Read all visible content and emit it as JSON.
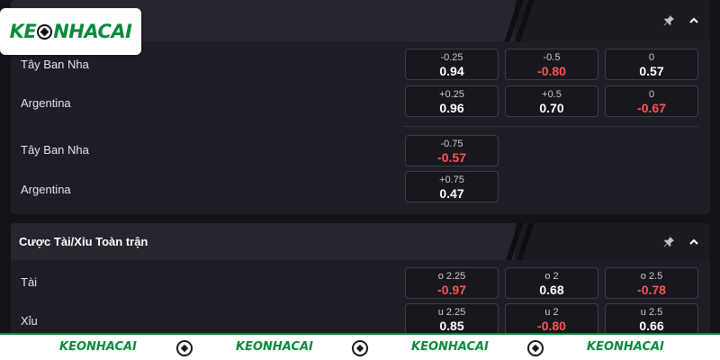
{
  "logo": {
    "part1": "KE",
    "part2": "NHACAI"
  },
  "panel1": {
    "handicap": {
      "rows": [
        {
          "team": "Tây Ban Nha",
          "odds": [
            {
              "line": "-0.25",
              "price": "0.94",
              "neg": false
            },
            {
              "line": "-0.5",
              "price": "-0.80",
              "neg": true
            },
            {
              "line": "0",
              "price": "0.57",
              "neg": false
            }
          ]
        },
        {
          "team": "Argentina",
          "odds": [
            {
              "line": "+0.25",
              "price": "0.96",
              "neg": false
            },
            {
              "line": "+0.5",
              "price": "0.70",
              "neg": false
            },
            {
              "line": "0",
              "price": "-0.67",
              "neg": true
            }
          ]
        }
      ]
    },
    "extra": {
      "rows": [
        {
          "team": "Tây Ban Nha",
          "odds": [
            {
              "line": "-0.75",
              "price": "-0.57",
              "neg": true
            }
          ]
        },
        {
          "team": "Argentina",
          "odds": [
            {
              "line": "+0.75",
              "price": "0.47",
              "neg": false
            }
          ]
        }
      ]
    }
  },
  "panel2": {
    "title": "Cược Tài/Xỉu Toàn trận",
    "rows": [
      {
        "team": "Tài",
        "odds": [
          {
            "line": "o 2.25",
            "price": "-0.97",
            "neg": true
          },
          {
            "line": "o 2",
            "price": "0.68",
            "neg": false
          },
          {
            "line": "o 2.5",
            "price": "-0.78",
            "neg": true
          }
        ]
      },
      {
        "team": "Xỉu",
        "odds": [
          {
            "line": "u 2.25",
            "price": "0.85",
            "neg": false
          },
          {
            "line": "u 2",
            "price": "-0.80",
            "neg": true
          },
          {
            "line": "u 2.5",
            "price": "0.66",
            "neg": false
          }
        ]
      }
    ]
  },
  "footer": {
    "logo_part1": "KE",
    "logo_part2": "NHACAI"
  },
  "colors": {
    "brand_green": "#0b8a3c",
    "negative_red": "#ff5252",
    "panel_bg": "#1d1e25"
  },
  "icons": [
    "pin-icon",
    "chevron-up-icon",
    "soccer-ball-icon"
  ]
}
